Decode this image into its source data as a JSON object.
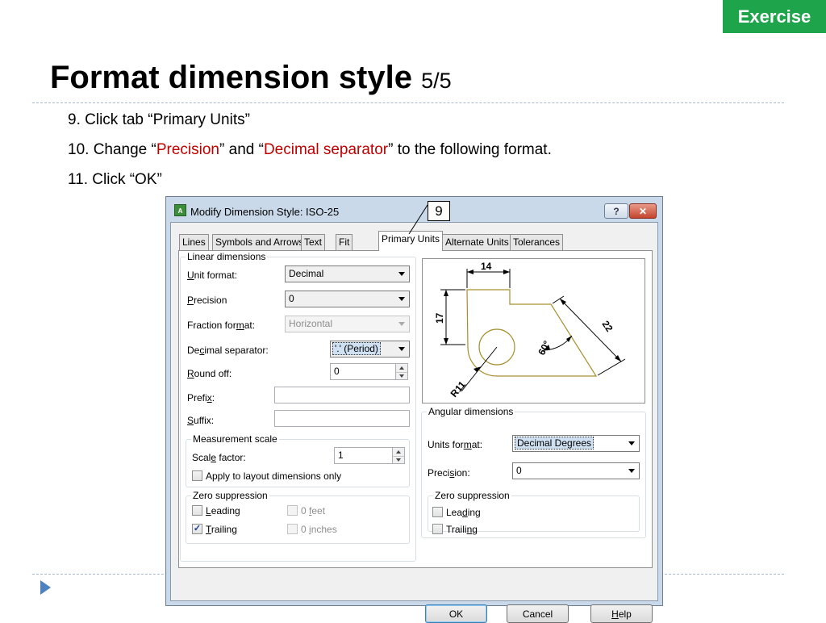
{
  "slide": {
    "badge": "Exercise",
    "title": "Format dimension style",
    "title_suffix": "5/5",
    "steps": {
      "s1": "9. Click tab “Primary Units”",
      "s2_a": "10. Change “",
      "s2_b": "Precision",
      "s2_c": "” and “",
      "s2_d": "Decimal separator",
      "s2_e": "” to the following format.",
      "s3": "11. Click “OK”"
    },
    "callout": "9"
  },
  "dialog": {
    "title": "Modify Dimension Style: ISO-25",
    "help_glyph": "?",
    "close_glyph": "✕",
    "tabs": [
      "Lines",
      "Symbols and Arrows",
      "Text",
      "Fit",
      "Primary Units",
      "Alternate Units",
      "Tolerances"
    ],
    "active_tab": "Primary Units",
    "linear": {
      "group_title": "Linear dimensions",
      "unit_format": {
        "label_pre": "",
        "label_u": "U",
        "label_post": "nit format:",
        "value": "Decimal"
      },
      "precision": {
        "label_pre": "",
        "label_u": "P",
        "label_post": "recision",
        "value": "0"
      },
      "fraction_format": {
        "label_pre": "Fraction for",
        "label_u": "m",
        "label_post": "at:",
        "value": "Horizontal"
      },
      "decimal_separator": {
        "label_pre": "De",
        "label_u": "c",
        "label_post": "imal separator:",
        "value": "'.' (Period)"
      },
      "round_off": {
        "label_pre": "",
        "label_u": "R",
        "label_post": "ound off:",
        "value": "0"
      },
      "prefix": {
        "label_pre": "Prefi",
        "label_u": "x",
        "label_post": ":",
        "value": ""
      },
      "suffix": {
        "label_pre": "",
        "label_u": "S",
        "label_post": "uffix:",
        "value": ""
      },
      "measurement": {
        "group_title": "Measurement scale",
        "scale_factor": {
          "label_pre": "Scal",
          "label_u": "e",
          "label_post": " factor:",
          "value": "1"
        },
        "apply_layout": {
          "label": "Apply to layout dimensions only",
          "checked": false
        }
      },
      "zero": {
        "group_title": "Zero suppression",
        "leading": {
          "label_pre": "",
          "label_u": "L",
          "label_post": "eading",
          "checked": false
        },
        "trailing": {
          "label_pre": "",
          "label_u": "T",
          "label_post": "railing",
          "checked": true,
          "mark": "✓"
        },
        "feet": {
          "label_pre": "0 ",
          "label_u": "f",
          "label_post": "eet",
          "checked": false
        },
        "inches": {
          "label_pre": "0 ",
          "label_u": "i",
          "label_post": "nches",
          "checked": false
        }
      }
    },
    "preview": {
      "dim_top": "14",
      "dim_left": "17",
      "dim_diag": "22",
      "dim_angle": "60°",
      "dim_radius": "R11"
    },
    "angular": {
      "group_title": "Angular dimensions",
      "units_format": {
        "label_pre": "Units for",
        "label_u": "m",
        "label_post": "at:",
        "value": "Decimal Degrees"
      },
      "precision": {
        "label_pre": "Preci",
        "label_u": "s",
        "label_post": "ion:",
        "value": "0"
      },
      "zero": {
        "group_title": "Zero suppression",
        "leading": {
          "label_pre": "Lea",
          "label_u": "d",
          "label_post": "ing",
          "checked": false
        },
        "trailing": {
          "label_pre": "Traili",
          "label_u": "n",
          "label_post": "g",
          "checked": false
        }
      }
    },
    "buttons": {
      "ok": "OK",
      "cancel": "Cancel",
      "help_pre": "",
      "help_u": "H",
      "help_post": "elp"
    }
  }
}
